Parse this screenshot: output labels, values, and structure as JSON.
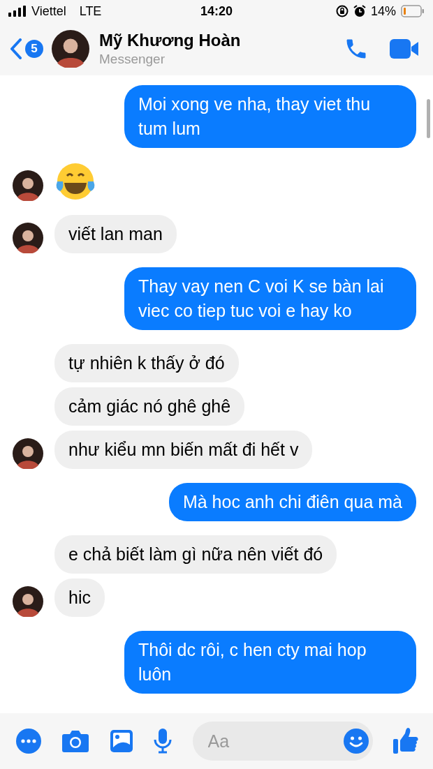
{
  "status_bar": {
    "carrier": "Viettel",
    "network": "LTE",
    "time": "14:20",
    "battery": "14%"
  },
  "header": {
    "back_badge": "5",
    "name": "Mỹ Khương Hoàn",
    "subtitle": "Messenger"
  },
  "messages": [
    {
      "kind": "out",
      "text": "Moi xong ve nha, thay viet thu tum lum"
    },
    {
      "kind": "emoji",
      "avatar": true
    },
    {
      "kind": "in",
      "text": "viết lan man",
      "avatar": true
    },
    {
      "kind": "out",
      "text": "Thay vay nen C voi K se bàn lai viec co tiep tuc voi e hay ko"
    },
    {
      "kind": "in",
      "text": "tự nhiên k thấy ở đó",
      "avatar": false
    },
    {
      "kind": "in",
      "text": "cảm giác nó ghê ghê",
      "avatar": false
    },
    {
      "kind": "in",
      "text": "như kiểu mn biến mất đi hết v",
      "avatar": true
    },
    {
      "kind": "out",
      "text": "Mà hoc anh chi điên qua mà"
    },
    {
      "kind": "in",
      "text": "e chả biết làm gì nữa nên viết đó",
      "avatar": false
    },
    {
      "kind": "in",
      "text": "hic",
      "avatar": true
    },
    {
      "kind": "out",
      "text": "Thôi dc rôi, c hen cty mai hop luôn"
    }
  ],
  "composer": {
    "placeholder": "Aa"
  }
}
